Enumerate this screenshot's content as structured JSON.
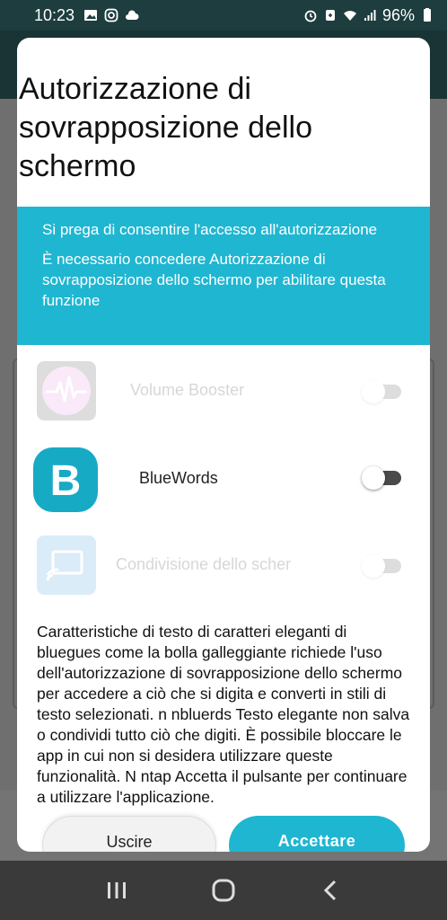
{
  "status_bar": {
    "time": "10:23",
    "battery": "96%"
  },
  "dialog": {
    "title": "Autorizzazione di sovrapposizione dello schermo",
    "banner": {
      "line1": "Si prega di consentire l'accesso all'autorizzazione",
      "line2": "È necessario concedere Autorizzazione di sovrapposizione dello schermo per abilitare questa funzione"
    },
    "apps": [
      {
        "name": "Volume Booster",
        "enabled": false,
        "toggle_on": false
      },
      {
        "name": "BlueWords",
        "enabled": true,
        "toggle_on": false,
        "icon_letter": "B"
      },
      {
        "name": "Condivisione dello scher",
        "enabled": false,
        "toggle_on": false
      }
    ],
    "description": "Caratteristiche di testo di caratteri eleganti di bluegues come la bolla galleggiante richiede l'uso dell'autorizzazione di sovrapposizione dello schermo per accedere a ciò che si digita e converti in stili di testo selezionati.  n  nbluerds Testo elegante non salva o condividi tutto ciò che digiti. È possibile bloccare le app in cui non si desidera utilizzare queste funzionalità.  N  ntap Accetta il pulsante per continuare a utilizzare l'applicazione.",
    "exit_label": "Uscire",
    "accept_label": "Accettare"
  },
  "colors": {
    "accent": "#1fb6d1",
    "status_bar_bg": "#1d3d3e"
  }
}
